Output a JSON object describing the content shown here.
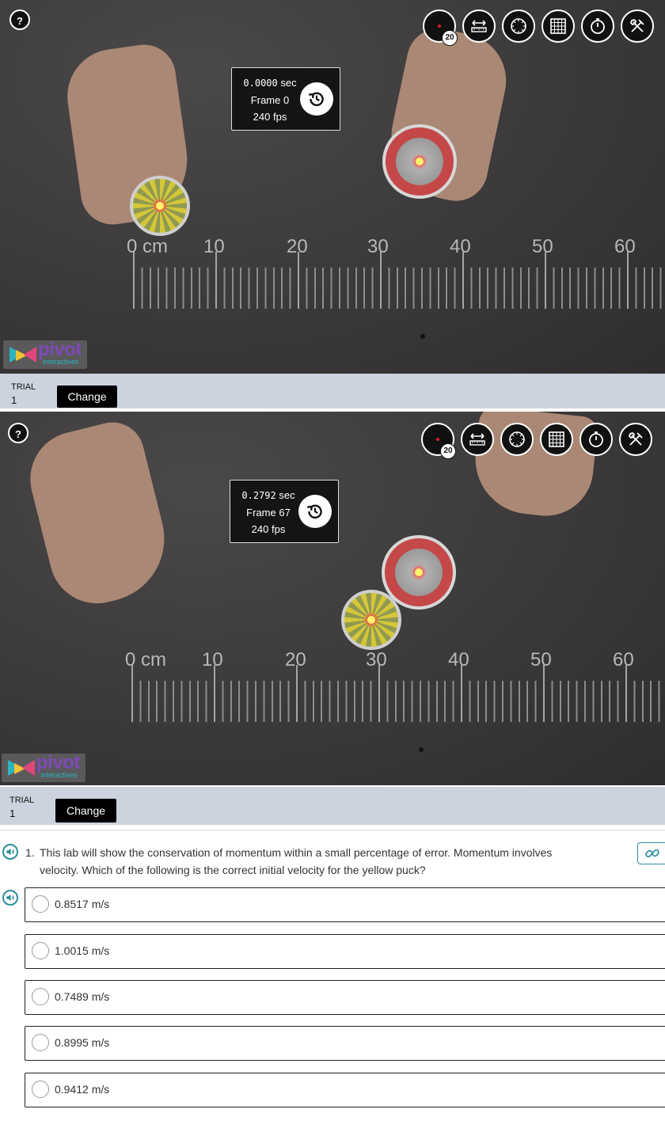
{
  "viewers": [
    {
      "help_label": "?",
      "time": "0.0000",
      "time_unit": "sec",
      "frame": "Frame 0",
      "fps": "240 fps",
      "ruler_labels": [
        "0 cm",
        "10",
        "20",
        "30",
        "40",
        "50",
        "60"
      ],
      "toolbar": {
        "point_badge": "20",
        "tools": [
          "point-tool-icon",
          "ruler-tool-icon",
          "protractor-icon",
          "grid-icon",
          "stopwatch-icon",
          "tools-icon"
        ]
      },
      "logo_word": "pivot",
      "logo_sub": "interactives"
    },
    {
      "help_label": "?",
      "time": "0.2792",
      "time_unit": "sec",
      "frame": "Frame 67",
      "fps": "240 fps",
      "ruler_labels": [
        "0 cm",
        "10",
        "20",
        "30",
        "40",
        "50",
        "60"
      ],
      "toolbar": {
        "point_badge": "20",
        "tools": [
          "point-tool-icon",
          "ruler-tool-icon",
          "protractor-icon",
          "grid-icon",
          "stopwatch-icon",
          "tools-icon"
        ]
      },
      "logo_word": "pivot",
      "logo_sub": "interactives"
    }
  ],
  "trials": [
    {
      "label": "TRIAL",
      "number": "1",
      "change_label": "Change"
    },
    {
      "label": "TRIAL",
      "number": "1",
      "change_label": "Change"
    }
  ],
  "question": {
    "number": "1.",
    "line1": "This lab will show the conservation of momentum within a small percentage of error. Momentum involves",
    "line2": "velocity. Which of the following is the correct initial velocity for the yellow puck?",
    "options": [
      "0.8517 m/s",
      "1.0015 m/s",
      "0.7489 m/s",
      "0.8995 m/s",
      "0.9412 m/s"
    ]
  },
  "colors": {
    "accent": "#2a8f98",
    "trial_bar": "#cbd4de",
    "viewer_bg": "#3d3b3c",
    "red_puck": "#c44848",
    "yellow_puck": "#d5c63a"
  }
}
